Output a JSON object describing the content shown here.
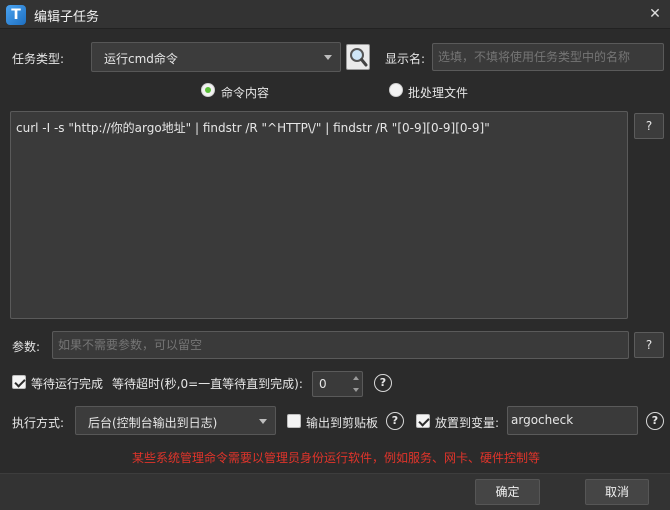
{
  "window": {
    "title": "编辑子任务",
    "app_icon_letter": "T",
    "close_symbol": "✕"
  },
  "task_type": {
    "label": "任务类型:",
    "value": "运行cmd命令"
  },
  "display_name": {
    "label": "显示名:",
    "placeholder": "选填，不填将使用任务类型中的名称"
  },
  "mode": {
    "options": [
      {
        "label": "命令内容",
        "selected": true
      },
      {
        "label": "批处理文件",
        "selected": false
      }
    ]
  },
  "command": {
    "value": "curl -I -s \"http://你的argo地址\" | findstr /R \"^HTTP\\/\" | findstr /R \"[0-9][0-9][0-9]\""
  },
  "params": {
    "label": "参数:",
    "placeholder": "如果不需要参数，可以留空"
  },
  "help_label": "?",
  "wait": {
    "checkbox_label": "等待运行完成",
    "checked": true,
    "timeout_label": "等待超时(秒,0=一直等待直到完成):",
    "timeout_value": "0"
  },
  "exec": {
    "label": "执行方式:",
    "value": "后台(控制台输出到日志)",
    "clipboard_label": "输出到剪贴板",
    "clipboard_checked": false,
    "var_label": "放置到变量:",
    "var_checked": true,
    "var_value": "argocheck"
  },
  "warning": "某些系统管理命令需要以管理员身份运行软件，例如服务、网卡、硬件控制等",
  "buttons": {
    "ok": "确定",
    "cancel": "取消"
  },
  "colors": {
    "accent_green": "#5bbf39",
    "warning_red": "#e0342b"
  }
}
